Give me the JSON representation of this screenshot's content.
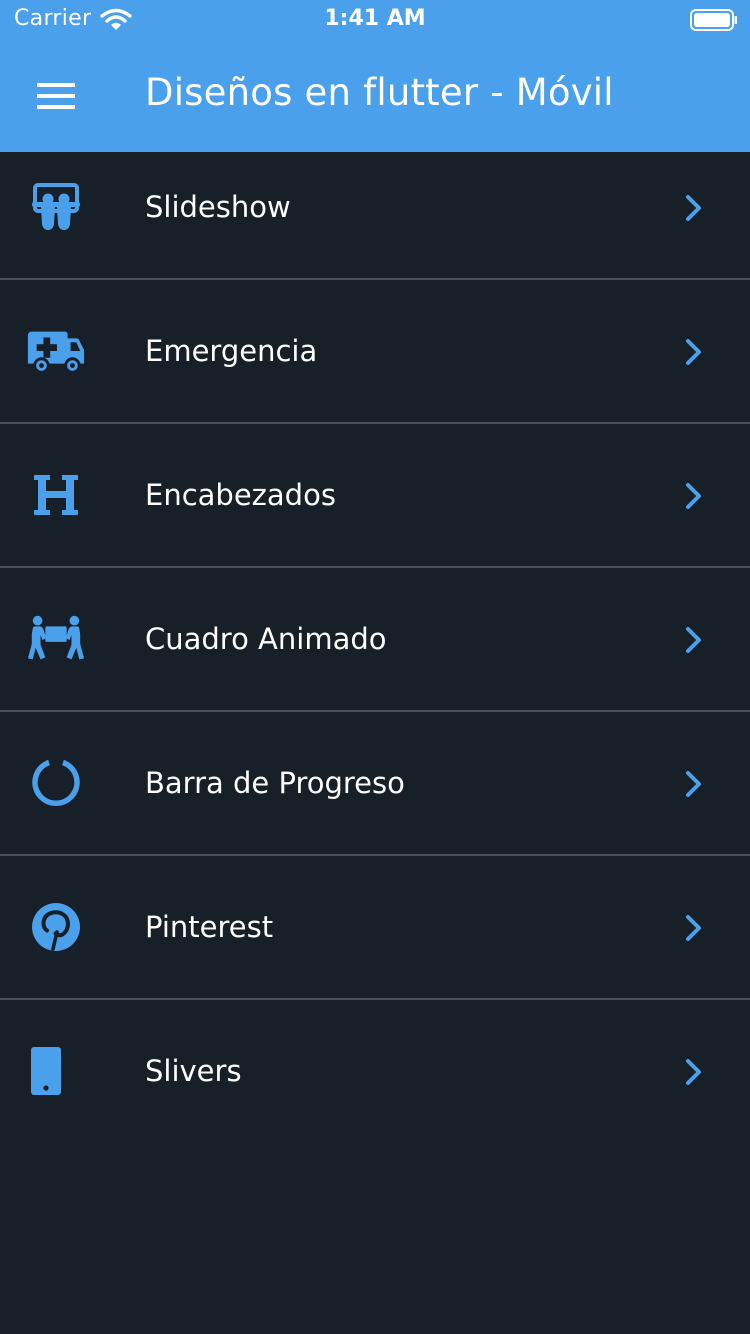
{
  "status_bar": {
    "carrier": "Carrier",
    "time": "1:41 AM"
  },
  "app_bar": {
    "title": "Diseños en flutter - Móvil",
    "menu_icon": "hamburger-menu-icon"
  },
  "colors": {
    "accent": "#4aa0ea",
    "background": "#171f29",
    "divider": "#4a5159",
    "text": "#ffffff"
  },
  "menu_items": [
    {
      "label": "Slideshow",
      "icon": "slideshare-icon"
    },
    {
      "label": "Emergencia",
      "icon": "ambulance-icon"
    },
    {
      "label": "Encabezados",
      "icon": "heading-icon"
    },
    {
      "label": "Cuadro Animado",
      "icon": "people-carry-icon"
    },
    {
      "label": "Barra de Progreso",
      "icon": "circle-notch-icon"
    },
    {
      "label": "Pinterest",
      "icon": "pinterest-icon"
    },
    {
      "label": "Slivers",
      "icon": "mobile-phone-icon"
    }
  ]
}
